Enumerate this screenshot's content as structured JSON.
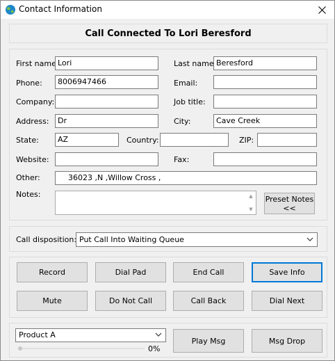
{
  "window": {
    "title": "Contact Information"
  },
  "banner": {
    "text": "Call Connected To Lori Beresford"
  },
  "contact": {
    "first_name_label": "First name:",
    "first_name_value": "Lori",
    "last_name_label": "Last name:",
    "last_name_value": "Beresford",
    "phone_label": "Phone:",
    "phone_value": "8006947466",
    "email_label": "Email:",
    "email_value": "",
    "company_label": "Company:",
    "company_value": "",
    "job_title_label": "Job title:",
    "job_title_value": "",
    "address_label": "Address:",
    "address_value": "Dr",
    "city_label": "City:",
    "city_value": "Cave Creek",
    "state_label": "State:",
    "state_value": "AZ",
    "country_label": "Country:",
    "country_value": "",
    "zip_label": "ZIP:",
    "zip_value": "",
    "website_label": "Website:",
    "website_value": "",
    "fax_label": "Fax:",
    "fax_value": "",
    "other_label": "Other:",
    "other_value": "36023 ,N ,Willow Cross ,",
    "notes_label": "Notes:",
    "notes_value": "",
    "preset_notes_line1": "Preset Notes",
    "preset_notes_line2": "<<"
  },
  "disposition": {
    "label": "Call disposition:",
    "selected": "Put Call Into Waiting Queue"
  },
  "actions": {
    "record": "Record",
    "dial_pad": "Dial Pad",
    "end_call": "End Call",
    "save_info": "Save Info",
    "mute": "Mute",
    "do_not_call": "Do Not Call",
    "call_back": "Call Back",
    "dial_next": "Dial Next"
  },
  "product": {
    "selected": "Product A",
    "progress": 0,
    "progress_text": "0%",
    "play_msg": "Play Msg",
    "msg_drop": "Msg Drop"
  }
}
